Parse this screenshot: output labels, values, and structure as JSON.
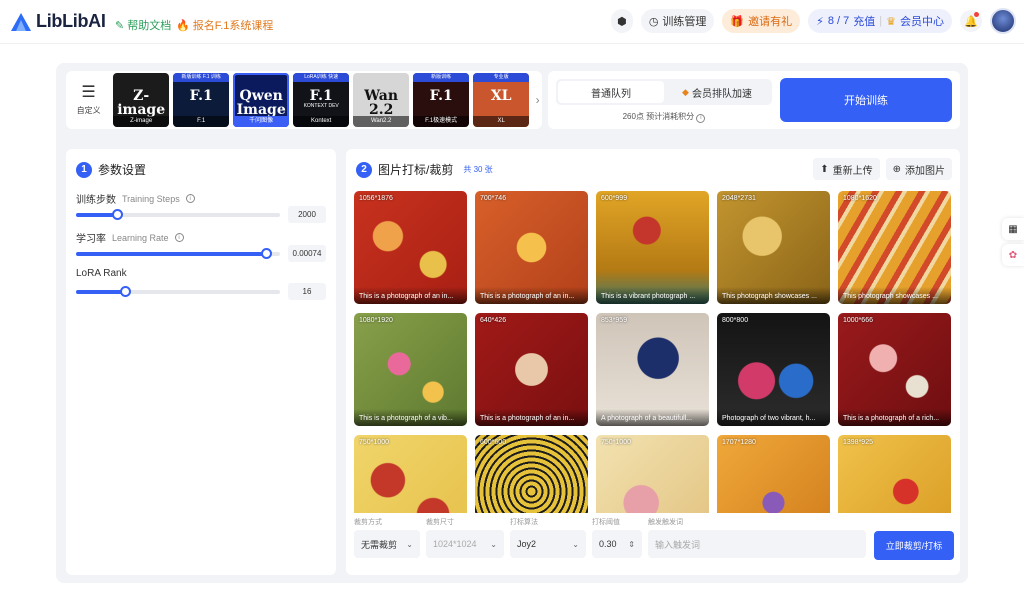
{
  "brand": {
    "name": "LibLibAI"
  },
  "header": {
    "help_link": "帮助文档",
    "course_link": "报名F.1系统课程",
    "training_manage": "训练管理",
    "invite": "邀请有礼",
    "points": "8 / 7",
    "recharge": "充值",
    "member_center": "会员中心"
  },
  "models": {
    "custom_label": "自定义",
    "items": [
      {
        "badge": "",
        "title": "Z-image",
        "sub": "",
        "caption": "Z-image",
        "bg": "#1b1b1b"
      },
      {
        "badge": "新版训练 F.1 训练",
        "title": "F.1",
        "sub": "",
        "caption": "F.1",
        "bg": "#0d1b3a"
      },
      {
        "badge": "",
        "title": "Qwen Image",
        "sub": "",
        "caption": "千问图像",
        "bg": "#0a1a5c"
      },
      {
        "badge": "LoRA训练 快速",
        "title": "F.1",
        "sub": "KONTEXT DEV",
        "caption": "Kontext",
        "bg": "#111319"
      },
      {
        "badge": "",
        "title": "Wan 2.2",
        "sub": "",
        "caption": "Wan2.2",
        "bg": "#d6d6d6"
      },
      {
        "badge": "新版训练",
        "title": "F.1",
        "sub": "",
        "caption": "F.1极速模式",
        "bg": "#2a0d0d"
      },
      {
        "badge": "专业版",
        "title": "XL",
        "sub": "",
        "caption": "XL",
        "bg": "#c9562c"
      }
    ]
  },
  "queue": {
    "tab_normal": "普通队列",
    "tab_vip": "会员排队加速",
    "estimate": "260点 预计消耗积分",
    "start_button": "开始训练"
  },
  "params": {
    "section_num": "1",
    "section_title": "参数设置",
    "steps": {
      "label": "训练步数",
      "en": "Training Steps",
      "value": "2000",
      "fraction": 0.2
    },
    "lr": {
      "label": "学习率",
      "en": "Learning Rate",
      "value": "0.00074",
      "fraction": 0.93
    },
    "rank": {
      "label": "LoRA Rank",
      "en": "",
      "value": "16",
      "fraction": 0.24
    }
  },
  "images": {
    "section_num": "2",
    "section_title": "图片打标/裁剪",
    "count": "共 30 张",
    "reupload": "重新上传",
    "add_image": "添加图片",
    "items": [
      {
        "dim": "1056*1876",
        "cap": "This is a photograph of an in...",
        "bg": "radial-gradient(circle at 30% 40%, #f0a24a 0 14%, transparent 15%), radial-gradient(circle at 70% 65%, #e8c04a 0 12%, transparent 13%), linear-gradient(135deg, #c8321e, #a81f14)"
      },
      {
        "dim": "700*746",
        "cap": "This is a photograph of an in...",
        "bg": "radial-gradient(circle at 50% 50%, #f5c04c 0 18%, transparent 19%), linear-gradient(135deg, #d8602a, #b2401a)"
      },
      {
        "dim": "600*999",
        "cap": "This is a vibrant photograph ...",
        "bg": "radial-gradient(circle at 45% 35%, #c4362c 0 14%, transparent 15%), linear-gradient(180deg, #e1a526, #b47a14 70%, #3c7a6c)"
      },
      {
        "dim": "2048*2731",
        "cap": "This photograph showcases ...",
        "bg": "radial-gradient(circle at 40% 40%, #e8c56a 0 20%, transparent 21%), linear-gradient(135deg, #c3952f, #8a6418)"
      },
      {
        "dim": "1080*1620",
        "cap": "This photograph showcases ...",
        "bg": "repeating-linear-gradient(120deg, #e6a12c 0 10px, #d24a2a 10px 16px, #f0d8a0 16px 20px)"
      },
      {
        "dim": "1080*1920",
        "cap": "This is a photograph of a vib...",
        "bg": "radial-gradient(circle at 40% 45%, #e96a9a 0 12%, transparent 13%), radial-gradient(circle at 70% 70%, #f2c24d 0 9%, transparent 10%), linear-gradient(135deg, #88a04a, #5e7a30)"
      },
      {
        "dim": "640*426",
        "cap": "This is a photograph of an in...",
        "bg": "radial-gradient(circle at 50% 50%, #e8c8a8 0 20%, transparent 21%), linear-gradient(135deg, #a11a18, #7a0f10)"
      },
      {
        "dim": "853*959",
        "cap": "A photograph of a beautifull...",
        "bg": "radial-gradient(circle at 55% 40%, #1c2f6b 0 22%, transparent 23%), linear-gradient(180deg, #cfc4b8, #e9e2d8)"
      },
      {
        "dim": "800*800",
        "cap": "Photograph of two vibrant, h...",
        "bg": "radial-gradient(circle at 35% 60%, #d23a6a 0 18%, transparent 19%), radial-gradient(circle at 70% 60%, #2a6cc9 0 16%, transparent 17%), linear-gradient(180deg, #141414, #2c2c2c)"
      },
      {
        "dim": "1000*666",
        "cap": "This is a photograph of a rich...",
        "bg": "radial-gradient(circle at 40% 40%, #f0b0b0 0 14%, transparent 15%), radial-gradient(circle at 70% 65%, #e8e0d0 0 10%, transparent 11%), linear-gradient(135deg, #9a1a1c, #6e0e10)"
      },
      {
        "dim": "750*1000",
        "cap": "",
        "bg": "radial-gradient(circle at 30% 40%, #c4382a 0 16%, transparent 17%), radial-gradient(circle at 70% 70%, #c4382a 0 14%, transparent 15%), linear-gradient(135deg, #f0d56a, #e6c04a)"
      },
      {
        "dim": "600*600",
        "cap": "",
        "bg": "repeating-radial-gradient(circle at 50% 50%, #e6c23a 0 4px, #1c1c1c 4px 6px)"
      },
      {
        "dim": "750*1000",
        "cap": "",
        "bg": "radial-gradient(circle at 40% 60%, #e8a0a8 0 18%, transparent 19%), linear-gradient(135deg, #f2e2b0, #e2c280)"
      },
      {
        "dim": "1707*1280",
        "cap": "",
        "bg": "radial-gradient(circle at 50% 60%, #8a5ab8 0 12%, transparent 13%), linear-gradient(135deg, #f0a83a, #d07c1a)"
      },
      {
        "dim": "1398*925",
        "cap": "",
        "bg": "radial-gradient(circle at 60% 50%, #d6322a 0 14%, transparent 15%), linear-gradient(135deg, #f0c24a, #d89a22)"
      }
    ]
  },
  "controls": {
    "crop_mode": {
      "label": "裁剪方式",
      "value": "无需裁剪"
    },
    "crop_size": {
      "label": "裁剪尺寸",
      "value": "1024*1024"
    },
    "tag_algo": {
      "label": "打标算法",
      "value": "Joy2"
    },
    "tag_threshold": {
      "label": "打标阈值",
      "value": "0.30"
    },
    "trigger": {
      "label": "触发触发词",
      "placeholder": "输入触发词"
    },
    "apply_button": "立即裁剪/打标"
  },
  "colors": {
    "accent": "#3560f5",
    "invite": "#d96a14"
  }
}
